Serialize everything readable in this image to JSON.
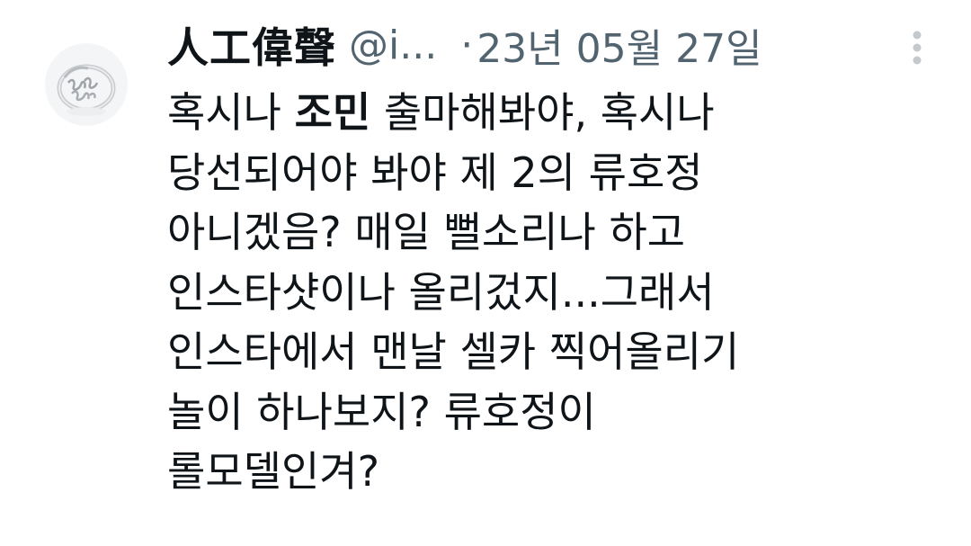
{
  "tweet": {
    "display_name": "人工偉聲",
    "handle": "@i...",
    "separator": "·",
    "date": "23년 05월 27일",
    "avatar_icon": "ring-avatar-icon",
    "more_icon": "more-vertical-icon",
    "lines": [
      {
        "pre": "혹시나 ",
        "bold": "조민",
        "post": " 출마해봐야, 혹시나"
      },
      {
        "pre": "당선되어야 봐야 제 2의 류호정"
      },
      {
        "pre": "아니겠음? 매일 뻘소리나 하고"
      },
      {
        "pre": "인스타샷이나 올리겄지...그래서"
      },
      {
        "pre": "인스타에서 맨날 셀카 찍어올리기"
      },
      {
        "pre": "놀이 하나보지? 류호정이"
      },
      {
        "pre": "롤모델인겨?"
      }
    ]
  }
}
